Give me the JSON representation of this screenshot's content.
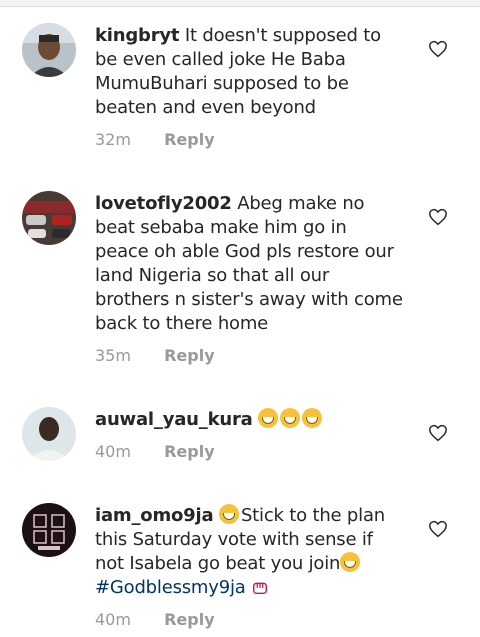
{
  "comments": [
    {
      "username": "kingbryt",
      "text": "It doesn't supposed to be even called joke He Baba MumuBuhari supposed to be beaten and even beyond",
      "time": "32m",
      "reply_label": "Reply",
      "avatar_icon": "person-selfie-avatar",
      "like_icon": "heart-outline-icon"
    },
    {
      "username": "lovetofly2002",
      "text": "Abeg make no beat sebaba make him go in peace oh able God pls restore our land Nigeria so that  all our brothers n sister's away with come back to there home",
      "time": "35m",
      "reply_label": "Reply",
      "avatar_icon": "cars-avatar",
      "like_icon": "heart-outline-icon"
    },
    {
      "username": "auwal_yau_kura",
      "text": "",
      "emojis": [
        "grinning-face",
        "grinning-face",
        "grinning-face"
      ],
      "time": "40m",
      "reply_label": "Reply",
      "avatar_icon": "person-avatar",
      "like_icon": "heart-outline-icon"
    },
    {
      "username": "iam_omo9ja",
      "text_part1": "Stick to the plan this Saturday vote with sense if not Isabela go beat you join",
      "hashtag": "#Godblessmy9ja",
      "time": "40m",
      "reply_label": "Reply",
      "avatar_icon": "logo-avatar",
      "like_icon": "heart-outline-icon"
    }
  ],
  "colors": {
    "text": "#262626",
    "meta": "#999999",
    "hashtag": "#003569"
  }
}
